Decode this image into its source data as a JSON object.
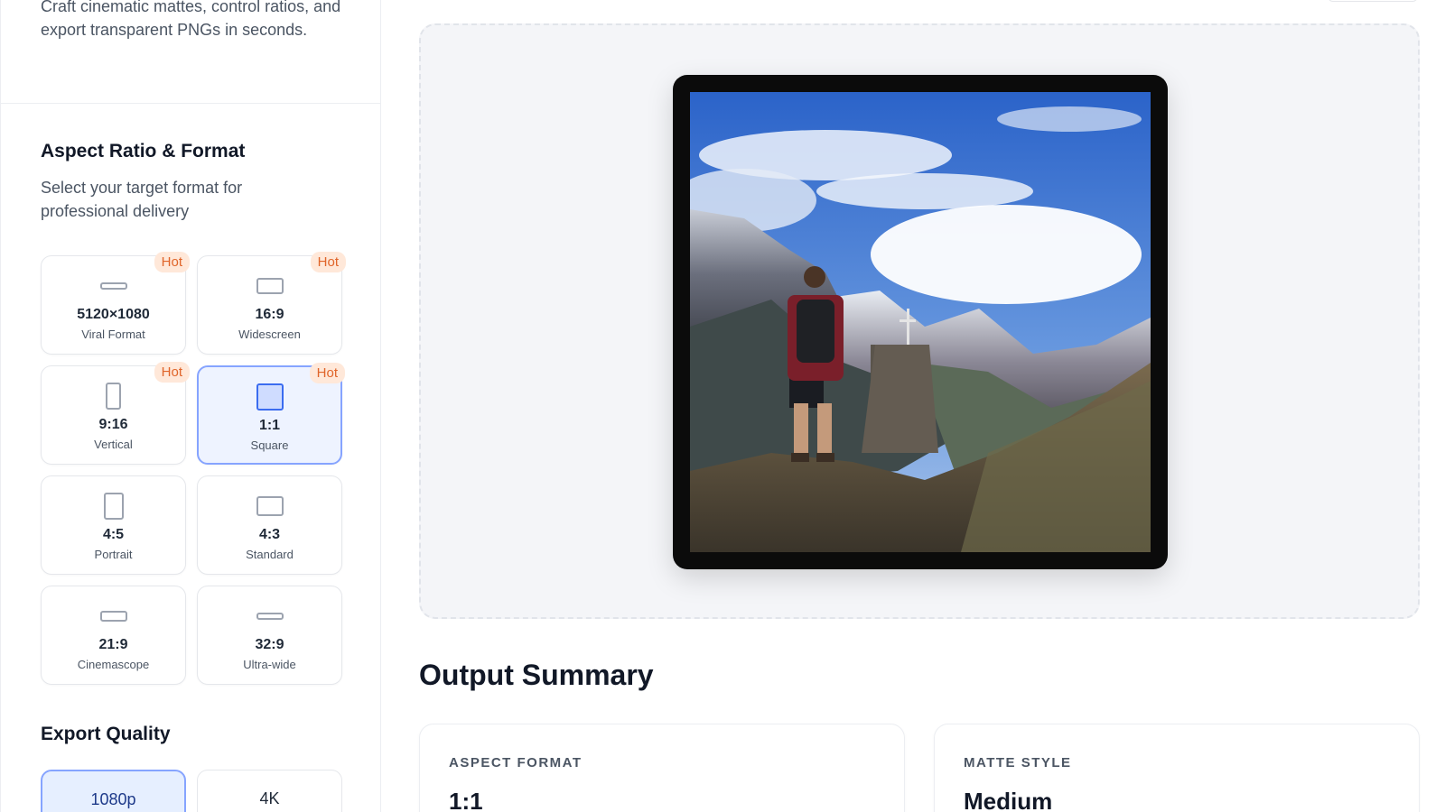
{
  "sidebar": {
    "intro_text": "Craft cinematic mattes, control ratios, and export transparent PNGs in seconds.",
    "aspect_section": {
      "title": "Aspect Ratio & Format",
      "description": "Select your target format for professional delivery",
      "options": [
        {
          "label": "5120×1080",
          "sublabel": "Viral Format",
          "badge": "Hot",
          "icon": "ultra-wide-frame-icon",
          "selected": false
        },
        {
          "label": "16:9",
          "sublabel": "Widescreen",
          "badge": "Hot",
          "icon": "widescreen-frame-icon",
          "selected": false
        },
        {
          "label": "9:16",
          "sublabel": "Vertical",
          "badge": "Hot",
          "icon": "vertical-frame-icon",
          "selected": false
        },
        {
          "label": "1:1",
          "sublabel": "Square",
          "badge": "Hot",
          "icon": "square-frame-icon",
          "selected": true
        },
        {
          "label": "4:5",
          "sublabel": "Portrait",
          "badge": "",
          "icon": "portrait-frame-icon",
          "selected": false
        },
        {
          "label": "4:3",
          "sublabel": "Standard",
          "badge": "",
          "icon": "standard-frame-icon",
          "selected": false
        },
        {
          "label": "21:9",
          "sublabel": "Cinemascope",
          "badge": "",
          "icon": "cinemascope-frame-icon",
          "selected": false
        },
        {
          "label": "32:9",
          "sublabel": "Ultra-wide",
          "badge": "",
          "icon": "ultra-wide-frame-icon",
          "selected": false
        }
      ]
    },
    "quality_section": {
      "title": "Export Quality",
      "options": [
        {
          "label": "1080p",
          "selected": true
        },
        {
          "label": "4K",
          "selected": false
        }
      ]
    }
  },
  "summary": {
    "title": "Output Summary",
    "cards": [
      {
        "label": "ASPECT FORMAT",
        "value": "1:1"
      },
      {
        "label": "MATTE STYLE",
        "value": "Medium"
      }
    ]
  },
  "colors": {
    "accent": "#3b6cf0",
    "selected_bg": "#eef3ff",
    "hot_badge_bg": "#ffe8d9",
    "hot_badge_text": "#e0652a",
    "matte": "#0b0b0b"
  }
}
